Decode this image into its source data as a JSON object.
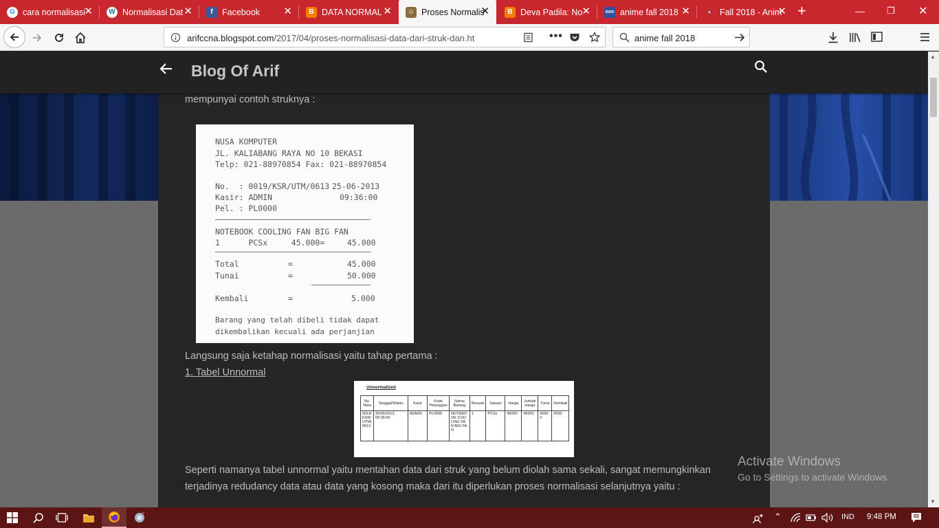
{
  "browser": {
    "tabs": [
      {
        "label": "cara normalisasi",
        "icon": "google-icon",
        "active": false
      },
      {
        "label": "Normalisasi Dat",
        "icon": "wordpress-icon",
        "active": false
      },
      {
        "label": "Facebook",
        "icon": "facebook-icon",
        "active": false
      },
      {
        "label": "DATA NORMAL",
        "icon": "blogger-icon",
        "active": false
      },
      {
        "label": "Proses Normalis",
        "icon": "blog-favicon-icon",
        "active": true
      },
      {
        "label": "Deva Padila: No",
        "icon": "blogger-icon",
        "active": false
      },
      {
        "label": "anime fall 2018",
        "icon": "anime-site-icon",
        "active": false
      },
      {
        "label": "Fall 2018 - Anim",
        "icon": "dot-icon",
        "active": false
      }
    ],
    "url": {
      "prefix": "arifccna.blogspot.com",
      "path": "/2017/04/proses-normalisasi-data-dari-struk-dan.ht"
    },
    "search_value": "anime fall 2018",
    "accent": "#c8282d"
  },
  "blog": {
    "title": "Blog Of Arif",
    "intro": "mempunyai contoh struknya :",
    "step_intro": "Langsung saja ketahap normalisasi yaitu tahap pertama :",
    "step1_link": "1. Tabel Unnormal",
    "para1_line1": "Seperti namanya tabel unnormal yaitu mentahan data dari struk yang belum diolah sama sekali, sangat memungkinkan",
    "para1_line2": "terjadinya redudancy data atau data yang kosong maka dari itu diperlukan proses normalisasi selanjutnya yaitu :"
  },
  "receipt": {
    "store": "NUSA KOMPUTER",
    "address": "JL. KALIABANG RAYA NO 10 BEKASI",
    "phone": "Telp: 021-88970854 Fax: 021-88970854",
    "no_label": "No.  : 0019/KSR/UTM/0613",
    "date": "25-06-2013",
    "kasir": "Kasir: ADMIN",
    "time": "09:36:00",
    "pel": "Pel. : PL0000",
    "item": "NOTEBOOK COOLING FAN BIG FAN",
    "qty_line": "1      PCSx     45.000=",
    "item_total": "45.000",
    "total_label": "Total",
    "total_value": "45.000",
    "tunai_label": "Tunai",
    "tunai_value": "50.000",
    "kembali_label": "Kembali",
    "kembali_value": "5.000",
    "eq": "=",
    "footer1": "Barang yang telah dibeli tidak dapat",
    "footer2": "dikembalikan kecuali ada perjanjian"
  },
  "unnormal_table": {
    "title": "Unnormalized",
    "headers": [
      "No. Nota",
      "Tanggal/Waktu",
      "Kasir",
      "Kode Pelanggan",
      "Nama Barang",
      "Banyak",
      "Satuan",
      "Harga",
      "Jumlah Harga",
      "Tunai",
      "Kembali"
    ],
    "row": [
      "0019/KSR/UTM/0613",
      "25/06/2013, 09:36:00",
      "ADMIN",
      "PL0000",
      "NOTEBOOK COOLING FAN BIG FAN",
      "1",
      "PCSx",
      "45000",
      "45000",
      "50000",
      "5000"
    ]
  },
  "watermark": {
    "title": "Activate Windows",
    "subtitle": "Go to Settings to activate Windows."
  },
  "taskbar": {
    "lang": "IND",
    "time": "9:48 PM"
  }
}
